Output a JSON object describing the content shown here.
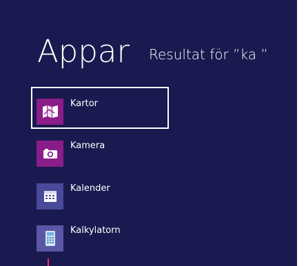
{
  "header": {
    "title": "Appar",
    "subtitle": "Resultat för ”ka ”"
  },
  "results": [
    {
      "label": "Kartor",
      "icon": "maps-icon",
      "tile_color": "#8b1d8a",
      "selected": true
    },
    {
      "label": "Kamera",
      "icon": "camera-icon",
      "tile_color": "#8b1d8a",
      "selected": false
    },
    {
      "label": "Kalender",
      "icon": "calendar-icon",
      "tile_color": "#4a4a9a",
      "selected": false
    },
    {
      "label": "Kalkylatorn",
      "icon": "calculator-icon",
      "tile_color": "#5b57a6",
      "selected": false
    }
  ],
  "colors": {
    "background": "#191a4f",
    "accent": "#ff2a68",
    "text": "#ffffff"
  }
}
